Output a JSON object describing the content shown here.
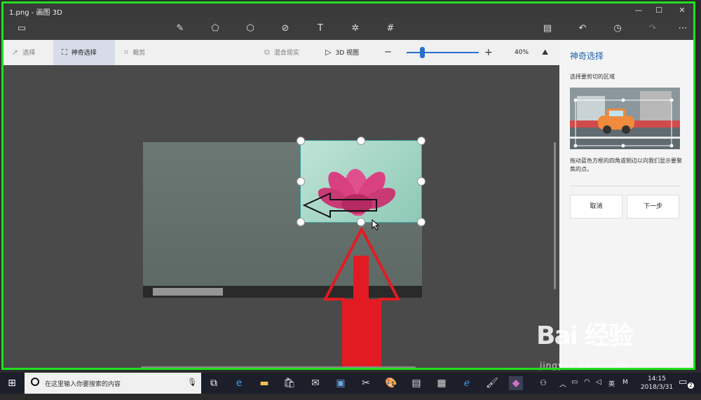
{
  "window": {
    "title": "1.png - 画图 3D"
  },
  "toolbar": {
    "icons": [
      "folder-icon",
      "brush-icon",
      "2d-shapes-icon",
      "3d-shapes-icon",
      "stickers-icon",
      "text-icon",
      "effects-icon",
      "canvas-icon",
      "paste-icon",
      "undo-icon",
      "history-icon",
      "redo-icon",
      "more-icon"
    ]
  },
  "subbar": {
    "select_label": "选择",
    "magic_select_label": "神奇选择",
    "crop_label": "裁剪",
    "mixed_reality_label": "混合现实",
    "view3d_label": "3D 视图",
    "zoom_value": "40%",
    "zoom_fraction": 0.22
  },
  "panel": {
    "title": "神奇选择",
    "subtitle": "选择要剪切的区域",
    "description": "拖动蓝色方框的四角或侧边以向我们显示要聚焦的点。",
    "cancel_label": "取消",
    "next_label": "下一步"
  },
  "taskbar": {
    "search_placeholder": "在这里输入你要搜索的内容",
    "ime_label": "英",
    "ime_mode": "M",
    "time": "14:15",
    "date": "2018/3/31",
    "notification_count": "2"
  },
  "watermark": {
    "logo_text": "Bai 经验",
    "url": "jingyan.baidu.com"
  },
  "colors": {
    "accent": "#1a5fb4",
    "highlight_border": "#1fe01f",
    "arrow_red": "#e21b23"
  }
}
